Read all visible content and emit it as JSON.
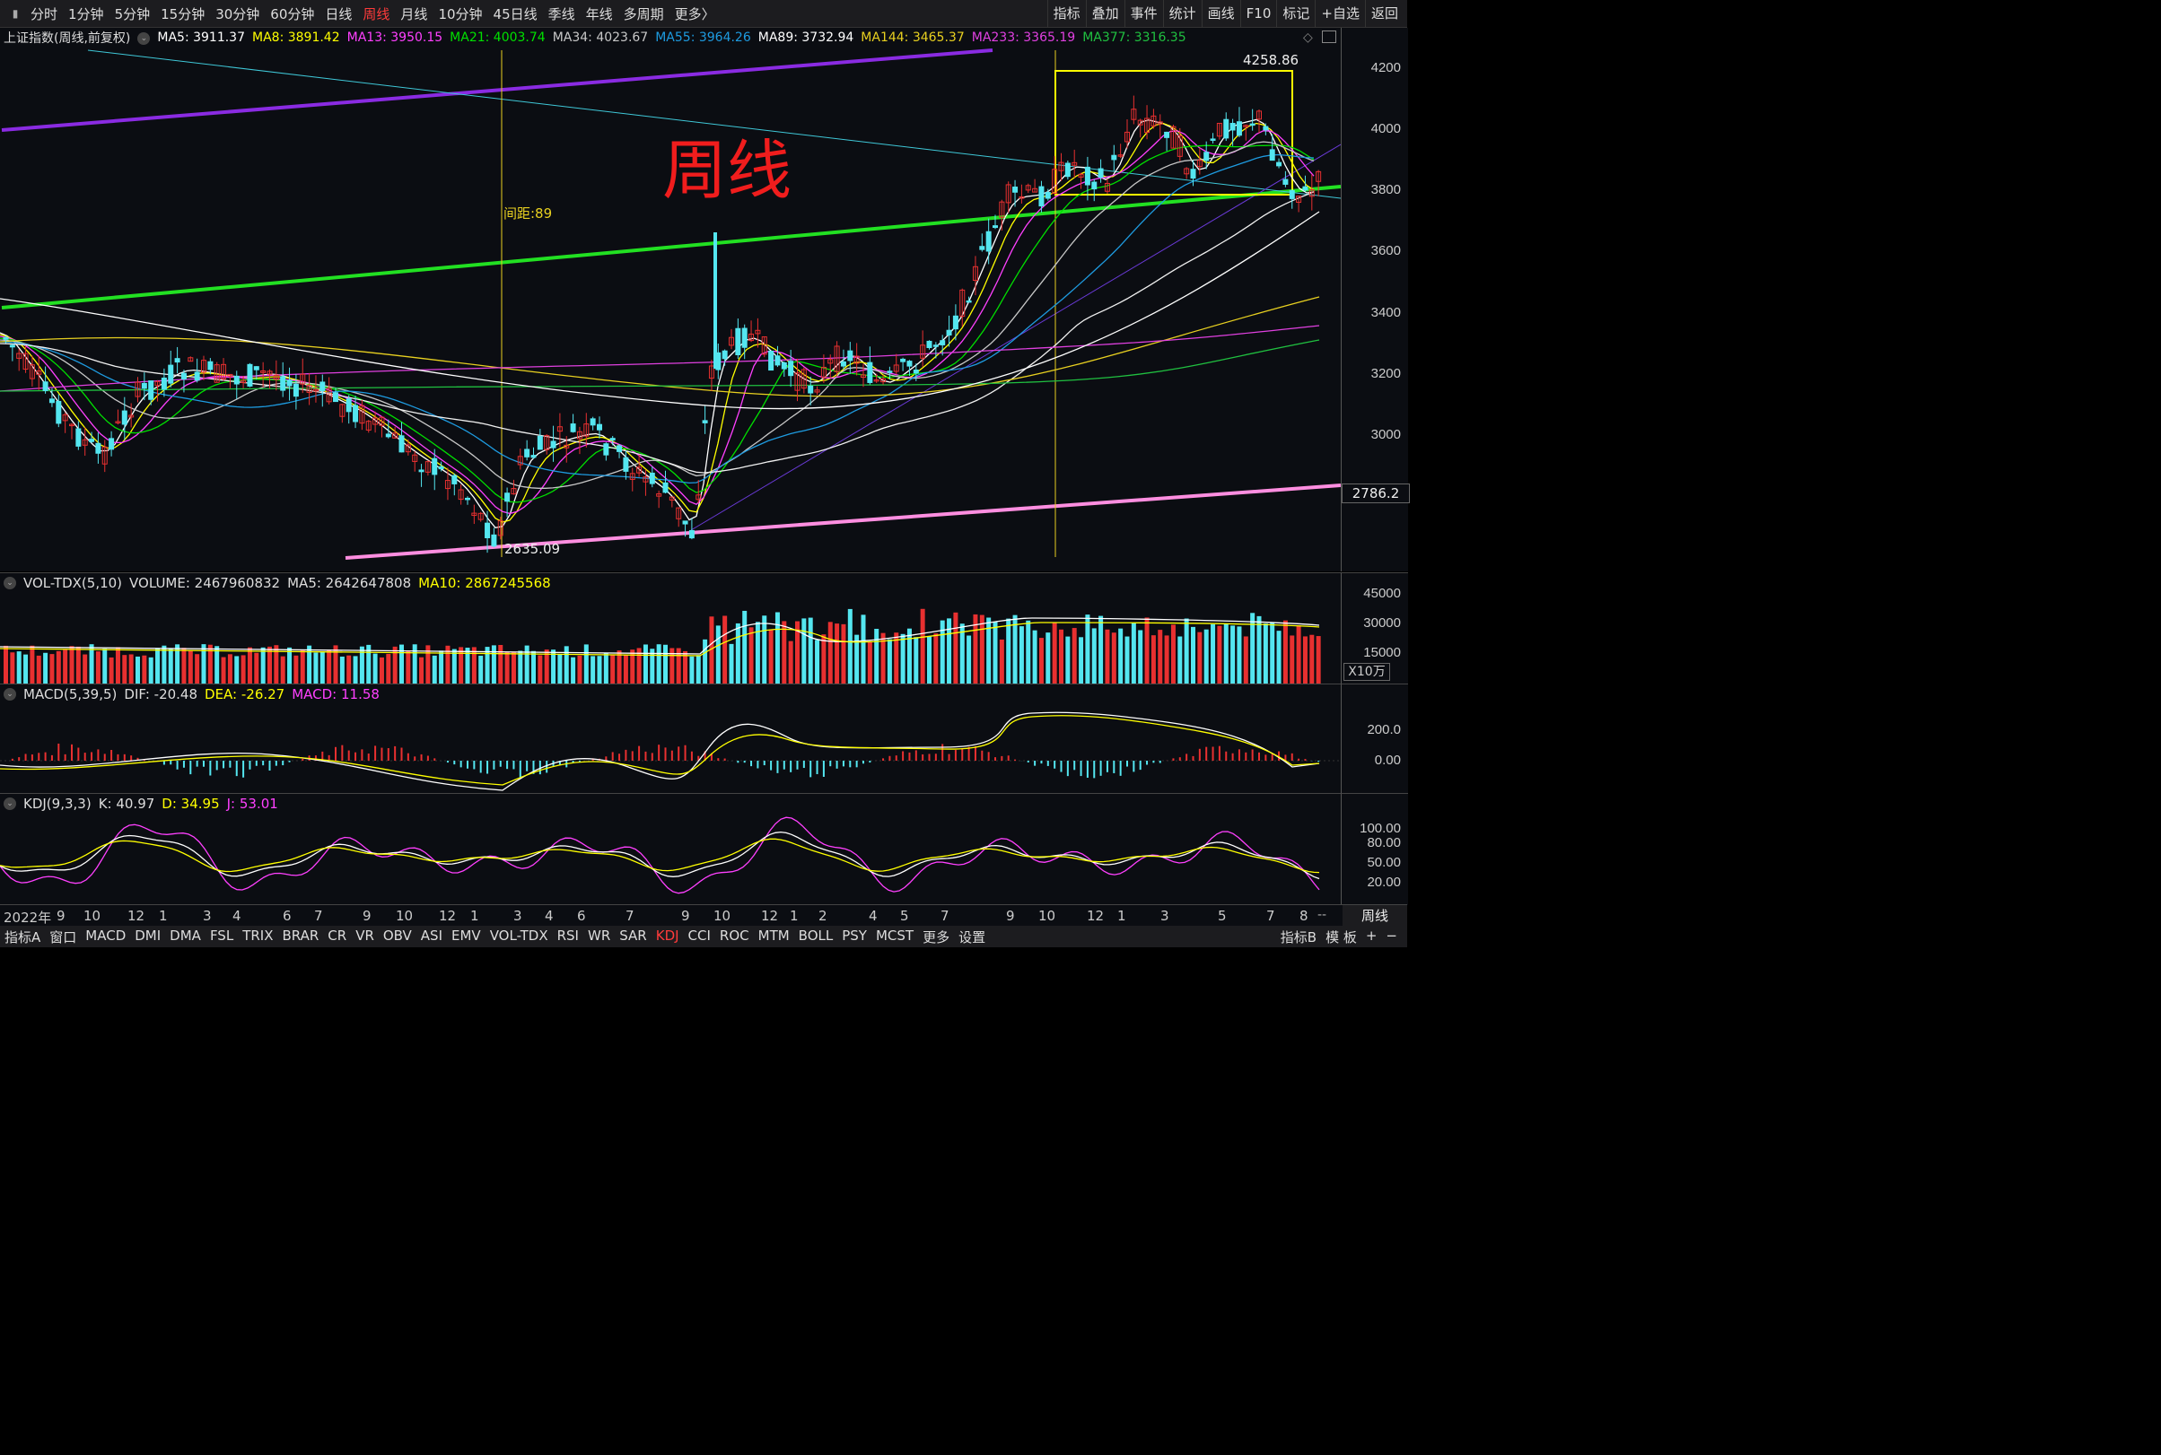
{
  "topbar": {
    "periods": [
      "分时",
      "1分钟",
      "5分钟",
      "15分钟",
      "30分钟",
      "60分钟",
      "日线",
      "周线",
      "月线",
      "10分钟",
      "45日线",
      "季线",
      "年线",
      "多周期",
      "更多〉"
    ],
    "active_period": "周线",
    "right_buttons": [
      "指标",
      "叠加",
      "事件",
      "统计",
      "画线",
      "F10",
      "标记",
      "+自选",
      "返回"
    ]
  },
  "main": {
    "title": "上证指数(周线,前复权)",
    "ma": [
      {
        "label": "MA5: 3911.37",
        "color": "#ffffff"
      },
      {
        "label": "MA8: 3891.42",
        "color": "#ffff00"
      },
      {
        "label": "MA13: 3950.15",
        "color": "#ff40ff"
      },
      {
        "label": "MA21: 4003.74",
        "color": "#00e000"
      },
      {
        "label": "MA34: 4023.67",
        "color": "#c8c8c8"
      },
      {
        "label": "MA55: 3964.26",
        "color": "#1e9be0"
      },
      {
        "label": "MA89: 3732.94",
        "color": "#ffffff"
      },
      {
        "label": "MA144: 3465.37",
        "color": "#e8d020"
      },
      {
        "label": "MA233: 3365.19",
        "color": "#e040e0"
      },
      {
        "label": "MA377: 3316.35",
        "color": "#20c040"
      }
    ],
    "watermark": "周线",
    "annotations": {
      "high": "4258.86",
      "low": "2635.09",
      "spacing": "间距:89",
      "right_level": "2786.2"
    },
    "y_ticks": [
      "4200",
      "4000",
      "3800",
      "3600",
      "3400",
      "3200",
      "3000"
    ]
  },
  "volume": {
    "header": [
      {
        "label": "VOL-TDX(5,10)",
        "color": "#dddddd"
      },
      {
        "label": "VOLUME: 2467960832",
        "color": "#dddddd"
      },
      {
        "label": "MA5: 2642647808",
        "color": "#dddddd"
      },
      {
        "label": "MA10: 2867245568",
        "color": "#ffff00"
      }
    ],
    "y_ticks": [
      "45000",
      "30000",
      "15000"
    ],
    "unit": "X10万"
  },
  "macd": {
    "header": [
      {
        "label": "MACD(5,39,5)",
        "color": "#dddddd"
      },
      {
        "label": "DIF: -20.48",
        "color": "#dddddd"
      },
      {
        "label": "DEA: -26.27",
        "color": "#ffff00"
      },
      {
        "label": "MACD: 11.58",
        "color": "#ff40ff"
      }
    ],
    "y_ticks": [
      "200.0",
      "0.00"
    ]
  },
  "kdj": {
    "header": [
      {
        "label": "KDJ(9,3,3)",
        "color": "#dddddd"
      },
      {
        "label": "K: 40.97",
        "color": "#dddddd"
      },
      {
        "label": "D: 34.95",
        "color": "#ffff00"
      },
      {
        "label": "J: 53.01",
        "color": "#ff40ff"
      }
    ],
    "y_ticks": [
      "100.00",
      "80.00",
      "50.00",
      "20.00"
    ]
  },
  "time_axis": [
    "2022年",
    "9",
    "10",
    "12",
    "1",
    "3",
    "4",
    "6",
    "7",
    "9",
    "10",
    "12",
    "1",
    "3",
    "4",
    "6",
    "7",
    "9",
    "10",
    "12",
    "1",
    "2",
    "4",
    "5",
    "7",
    "9",
    "10",
    "12",
    "1",
    "3",
    "5",
    "7",
    "8"
  ],
  "time_axis_right": "周线",
  "bottom_tabs": [
    "指标A",
    "窗口",
    "MACD",
    "DMI",
    "DMA",
    "FSL",
    "TRIX",
    "BRAR",
    "CR",
    "VR",
    "OBV",
    "ASI",
    "EMV",
    "VOL-TDX",
    "RSI",
    "WR",
    "SAR",
    "KDJ",
    "CCI",
    "ROC",
    "MTM",
    "BOLL",
    "PSY",
    "MCST",
    "更多",
    "设置"
  ],
  "bottom_active": "KDJ",
  "bottom_right": [
    "指标B",
    "模 板",
    "+",
    "−"
  ],
  "colors": {
    "up": "#e83030",
    "down": "#54e6f0",
    "bg": "#0b0d12"
  }
}
